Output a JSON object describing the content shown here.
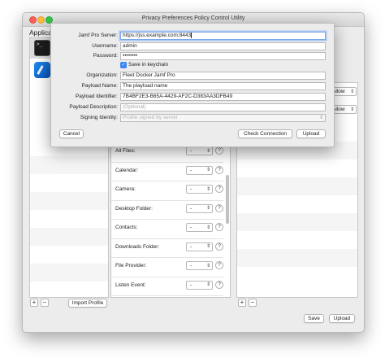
{
  "window": {
    "title": "Privacy Preferences Policy Control Utility"
  },
  "apps": {
    "heading": "Applicat",
    "items": [
      {
        "icon": "terminal-icon",
        "glyph": ">_"
      },
      {
        "icon": "xcode-icon"
      }
    ]
  },
  "services": [
    {
      "label": "All Files:",
      "value": "-"
    },
    {
      "label": "Calendar:",
      "value": "-"
    },
    {
      "label": "Camera:",
      "value": "-"
    },
    {
      "label": "Desktop Folder:",
      "value": "-"
    },
    {
      "label": "Contacts:",
      "value": "-"
    },
    {
      "label": "Downloads Folder:",
      "value": "-"
    },
    {
      "label": "File Provider:",
      "value": "-"
    },
    {
      "label": "Listen Event:",
      "value": "-"
    }
  ],
  "right_panel": {
    "allow_1": "Allow",
    "allow_2": "Allow"
  },
  "bottom": {
    "add": "+",
    "remove": "−",
    "import": "Import Profile",
    "add2": "+",
    "remove2": "−",
    "save": "Save",
    "upload": "Upload"
  },
  "sheet": {
    "server_label": "Jamf Pro Server:",
    "server_value": "https://jss.example.com:8443",
    "username_label": "Username:",
    "username_value": "admin",
    "password_label": "Password:",
    "password_value": "••••••••",
    "keychain_label": "Save in keychain",
    "org_label": "Organization:",
    "org_value": "Fleet Docker Jamf Pro",
    "payload_name_label": "Payload Name:",
    "payload_name_value": "The playload name",
    "payload_id_label": "Payload Identifier:",
    "payload_id_value": "7B4BF2E3-B65A-4429-AF2C-D383AA3DFB49",
    "payload_desc_label": "Payload Description:",
    "payload_desc_placeholder": "(Optional)",
    "signing_label": "Signing Identity:",
    "signing_value": "Profile signed by server",
    "cancel": "Cancel",
    "check": "Check Connection",
    "upload": "Upload",
    "question": "?"
  }
}
